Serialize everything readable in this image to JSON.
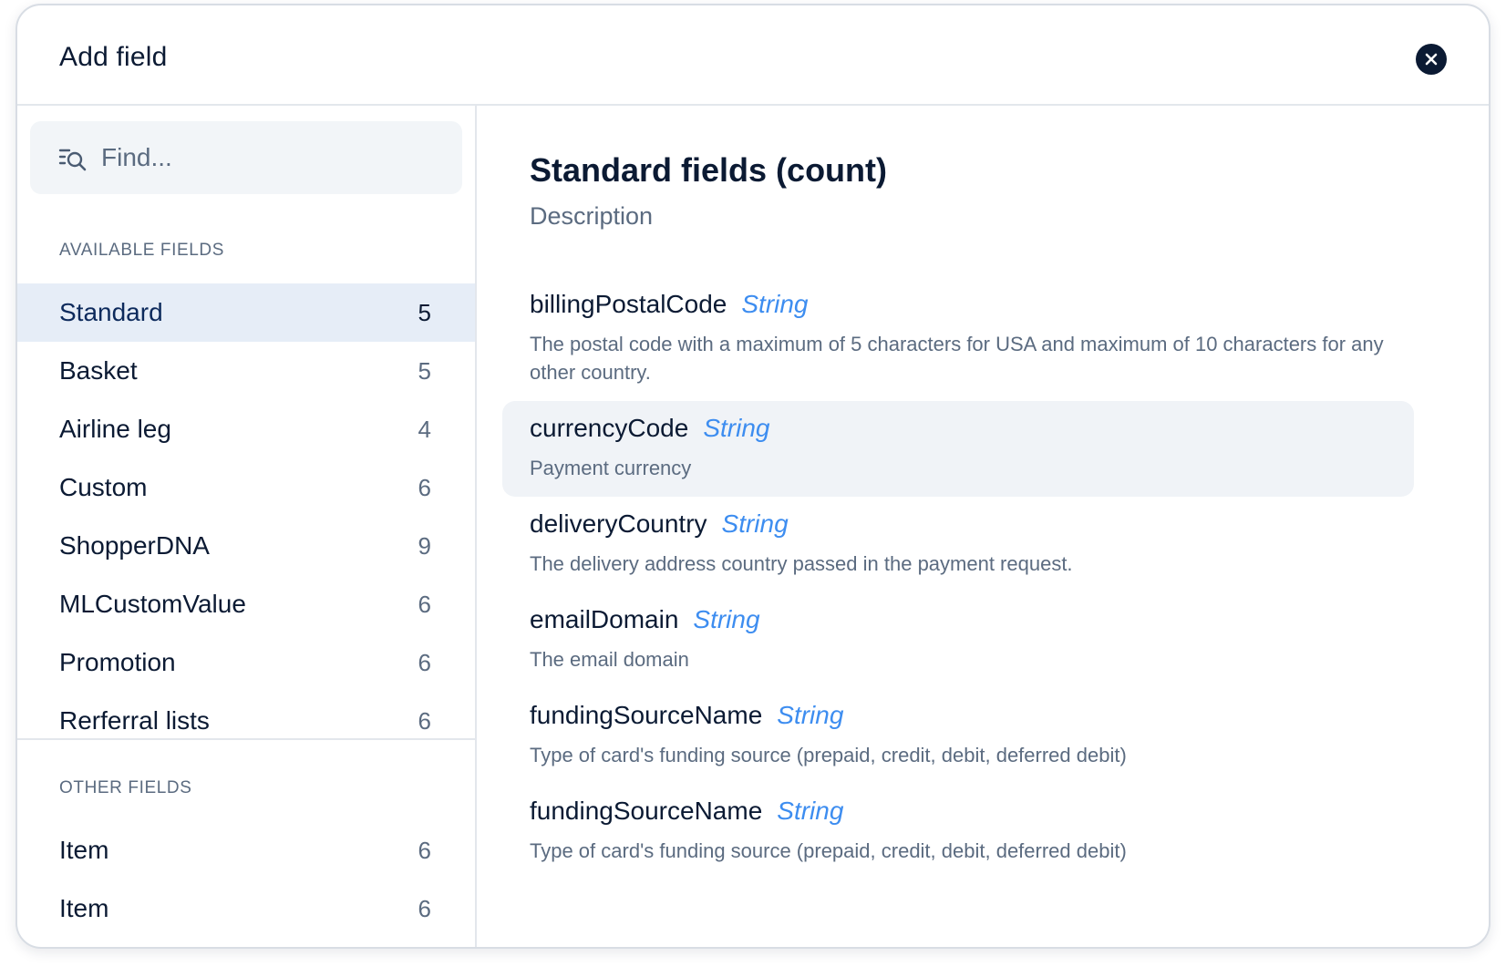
{
  "dialog": {
    "title": "Add field"
  },
  "search": {
    "placeholder": "Find..."
  },
  "sidebar": {
    "available_label": "AVAILABLE FIELDS",
    "available_items": [
      {
        "label": "Standard",
        "count": "5",
        "active": true
      },
      {
        "label": "Basket",
        "count": "5"
      },
      {
        "label": "Airline leg",
        "count": "4"
      },
      {
        "label": "Custom",
        "count": "6"
      },
      {
        "label": "ShopperDNA",
        "count": "9"
      },
      {
        "label": "MLCustomValue",
        "count": "6"
      },
      {
        "label": "Promotion",
        "count": "6"
      },
      {
        "label": "Rerferral lists",
        "count": "6"
      }
    ],
    "other_label": "OTHER FIELDS",
    "other_items": [
      {
        "label": "Item",
        "count": "6"
      },
      {
        "label": "Item",
        "count": "6"
      }
    ]
  },
  "main": {
    "title": "Standard fields (count)",
    "description": "Description",
    "fields": [
      {
        "name": "billingPostalCode",
        "type": "String",
        "desc": "The postal code with a maximum of 5 characters for USA and maximum of 10 characters for any other country."
      },
      {
        "name": "currencyCode",
        "type": "String",
        "desc": "Payment currency",
        "highlighted": true
      },
      {
        "name": "deliveryCountry",
        "type": "String",
        "desc": "The delivery address country passed in the payment request."
      },
      {
        "name": "emailDomain",
        "type": "String",
        "desc": "The email domain"
      },
      {
        "name": "fundingSourceName",
        "type": "String",
        "desc": "Type of card's funding source (prepaid, credit, debit, deferred debit)"
      },
      {
        "name": "fundingSourceName",
        "type": "String",
        "desc": "Type of card's funding source (prepaid, credit, debit, deferred debit)"
      }
    ]
  },
  "icons": {
    "close": "close-icon",
    "search": "search-list-icon"
  },
  "colors": {
    "primary_text": "#0b1a33",
    "muted_text": "#5b6b80",
    "type_accent": "#3d8df0",
    "active_bg": "#e6edf7",
    "hover_bg": "#f0f3f7"
  }
}
